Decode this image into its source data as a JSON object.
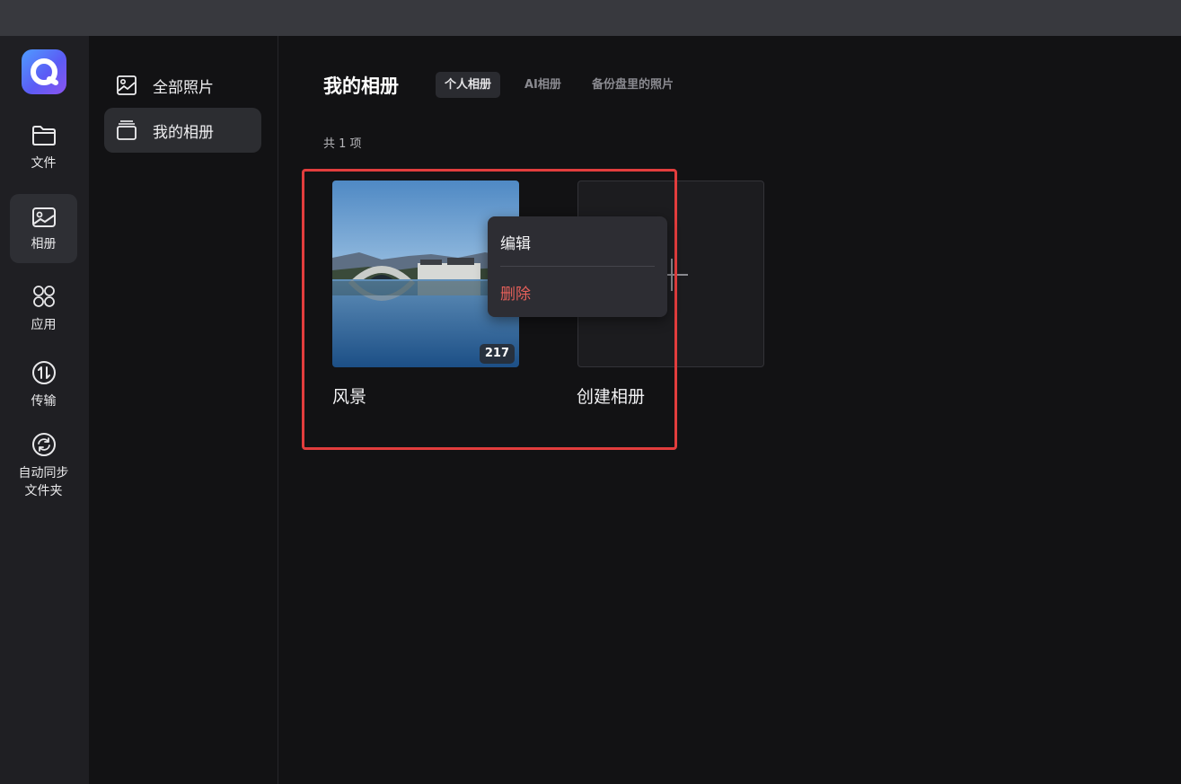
{
  "app": {
    "logo_icon": "app-logo-icon"
  },
  "rail": {
    "items": [
      {
        "label": "文件",
        "icon": "folder-icon"
      },
      {
        "label": "相册",
        "icon": "photo-album-icon",
        "active": true
      },
      {
        "label": "应用",
        "icon": "apps-grid-icon"
      },
      {
        "label": "传输",
        "icon": "transfer-icon"
      },
      {
        "label": "自动同步",
        "label2": "文件夹",
        "icon": "sync-icon"
      }
    ]
  },
  "sidebar": {
    "items": [
      {
        "label": "全部照片",
        "icon": "photo-icon"
      },
      {
        "label": "我的相册",
        "icon": "album-stack-icon",
        "active": true
      }
    ]
  },
  "main": {
    "title": "我的相册",
    "tabs": [
      {
        "label": "个人相册",
        "active": true
      },
      {
        "label": "AI相册"
      },
      {
        "label": "备份盘里的照片"
      }
    ],
    "count_text": "共 1 项",
    "albums": [
      {
        "name": "风景",
        "count": "217"
      }
    ],
    "create_album_label": "创建相册"
  },
  "context_menu": {
    "edit_label": "编辑",
    "delete_label": "删除",
    "delete_color": "#e5605a"
  },
  "colors": {
    "highlight": "#e23d3d",
    "accent": "#5b5cf5"
  }
}
